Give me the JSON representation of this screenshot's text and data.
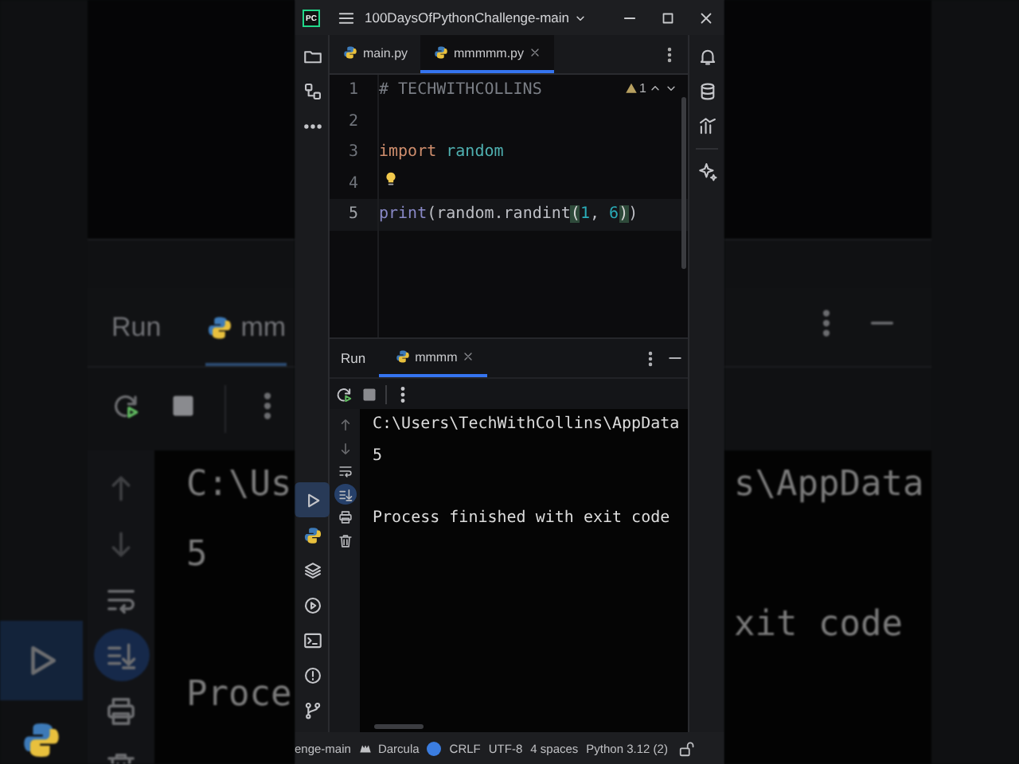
{
  "backdrop_left": {
    "tool_strip": [
      {
        "selected": true
      },
      {
        "selected": false
      }
    ],
    "run_title": "Run",
    "run_tab": "mm",
    "console_gutter": [
      {
        "disabled": true,
        "on": false
      },
      {
        "disabled": true,
        "on": false
      },
      {
        "disabled": false,
        "on": false
      },
      {
        "disabled": false,
        "on": true
      },
      {
        "disabled": false,
        "on": false
      },
      {
        "disabled": false,
        "on": false
      }
    ],
    "console_lines": [
      {
        "text": "C:\\Us",
        "gap_before": false
      },
      {
        "text": "5",
        "gap_before": false
      },
      {
        "text": "Proce",
        "gap_before": true
      }
    ]
  },
  "window": {
    "logo": "PC",
    "project": "100DaysOfPythonChallenge-main"
  },
  "left_tool_strip": {
    "top": [
      {
        "selected": false
      },
      {
        "selected": false
      },
      {
        "selected": false
      }
    ],
    "bottom": [
      {
        "selected": true
      },
      {
        "selected": false
      },
      {
        "selected": false
      },
      {
        "selected": false
      },
      {
        "selected": false
      },
      {
        "selected": false
      },
      {
        "selected": false
      }
    ]
  },
  "editor_tabs": [
    {
      "label": "main.py",
      "selected": false,
      "closable": false
    },
    {
      "label": "mmmmm.py",
      "selected": true,
      "closable": true
    }
  ],
  "editor": {
    "warning_count": "1",
    "lines": [
      {
        "number": "1",
        "bulb": false,
        "current": false,
        "tokens": [
          {
            "text": "# TECHWITHCOLLINS",
            "kind": "comment"
          }
        ]
      },
      {
        "number": "2",
        "bulb": false,
        "current": false
      },
      {
        "number": "3",
        "bulb": false,
        "current": false,
        "tokens": [
          {
            "text": "import",
            "kind": "keyword"
          },
          {
            "text": " random",
            "kind": "module"
          }
        ]
      },
      {
        "number": "4",
        "bulb": true,
        "current": false
      },
      {
        "number": "5",
        "bulb": false,
        "current": true,
        "tokens": [
          {
            "text": "print",
            "kind": "builtin"
          },
          {
            "text": "(random.randint",
            "kind": "plain"
          },
          {
            "text": "(",
            "kind": "matched"
          },
          {
            "text": "1",
            "kind": "number"
          },
          {
            "text": ", ",
            "kind": "plain"
          },
          {
            "text": "6",
            "kind": "number"
          },
          {
            "text": ")",
            "kind": "matched"
          },
          {
            "text": ")",
            "kind": "plain"
          }
        ]
      }
    ]
  },
  "run_panel": {
    "title": "Run",
    "tab": {
      "label": "mmmm",
      "selected": true
    },
    "console_gutter": [
      {
        "disabled": true,
        "on": false
      },
      {
        "disabled": true,
        "on": false
      },
      {
        "disabled": false,
        "on": false
      },
      {
        "disabled": false,
        "on": true
      },
      {
        "disabled": false,
        "on": false
      },
      {
        "disabled": false,
        "on": false
      }
    ],
    "console_lines": [
      {
        "text": "C:\\Users\\TechWithCollins\\AppData",
        "gap_before": false
      },
      {
        "text": "5",
        "gap_before": false
      },
      {
        "text": "Process finished with exit code",
        "gap_before": true
      }
    ]
  },
  "right_tool_strip": {
    "groups": [
      [
        {
          "selected": false
        },
        {
          "selected": false
        },
        {
          "selected": false
        }
      ],
      [
        {
          "selected": false
        }
      ]
    ]
  },
  "status_bar": [
    {
      "kind": "text",
      "text": "enge-main"
    },
    {
      "kind": "theme",
      "text": "Darcula"
    },
    {
      "kind": "dot"
    },
    {
      "kind": "text",
      "text": "CRLF"
    },
    {
      "kind": "text",
      "text": "UTF-8"
    },
    {
      "kind": "text",
      "text": "4 spaces"
    },
    {
      "kind": "text",
      "text": "Python 3.12 (2)"
    },
    {
      "kind": "lock"
    }
  ],
  "backdrop_right": {
    "console_lines": [
      {
        "text": "s\\AppData",
        "gap_before": false
      },
      {
        "text": "xit code",
        "gap_before": true
      }
    ]
  }
}
